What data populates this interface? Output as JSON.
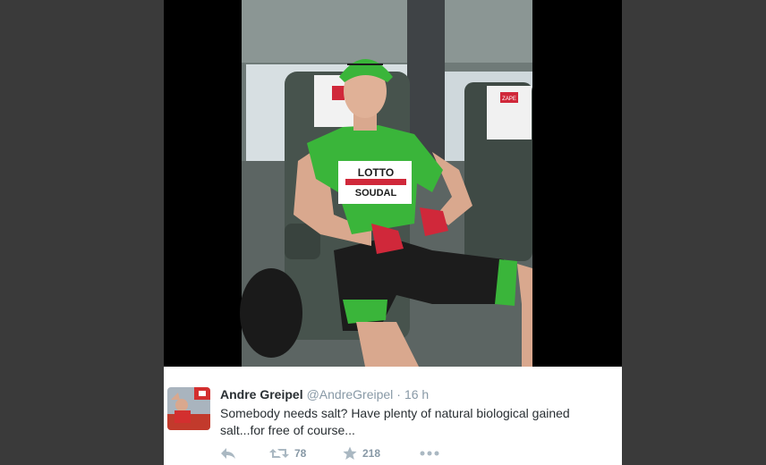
{
  "tweet": {
    "name": "Andre Greipel",
    "handle": "@AndreGreipel",
    "separator": "·",
    "time": "16 h",
    "text": "Somebody needs salt? Have plenty of natural biological gained salt...for free of course...",
    "retweets": "78",
    "favorites": "218"
  },
  "photo": {
    "jersey_text_1": "LOTTO",
    "jersey_text_2": "SOUDAL",
    "seat_tag": "ZAPE"
  },
  "icons": {
    "reply": "reply-icon",
    "retweet": "retweet-icon",
    "favorite": "star-icon",
    "more": "more-icon"
  },
  "colors": {
    "page_background": "#3a3a3a",
    "card_background": "#ffffff",
    "name": "#292f33",
    "meta": "#8899a6",
    "jersey_green": "#3ab53a"
  }
}
